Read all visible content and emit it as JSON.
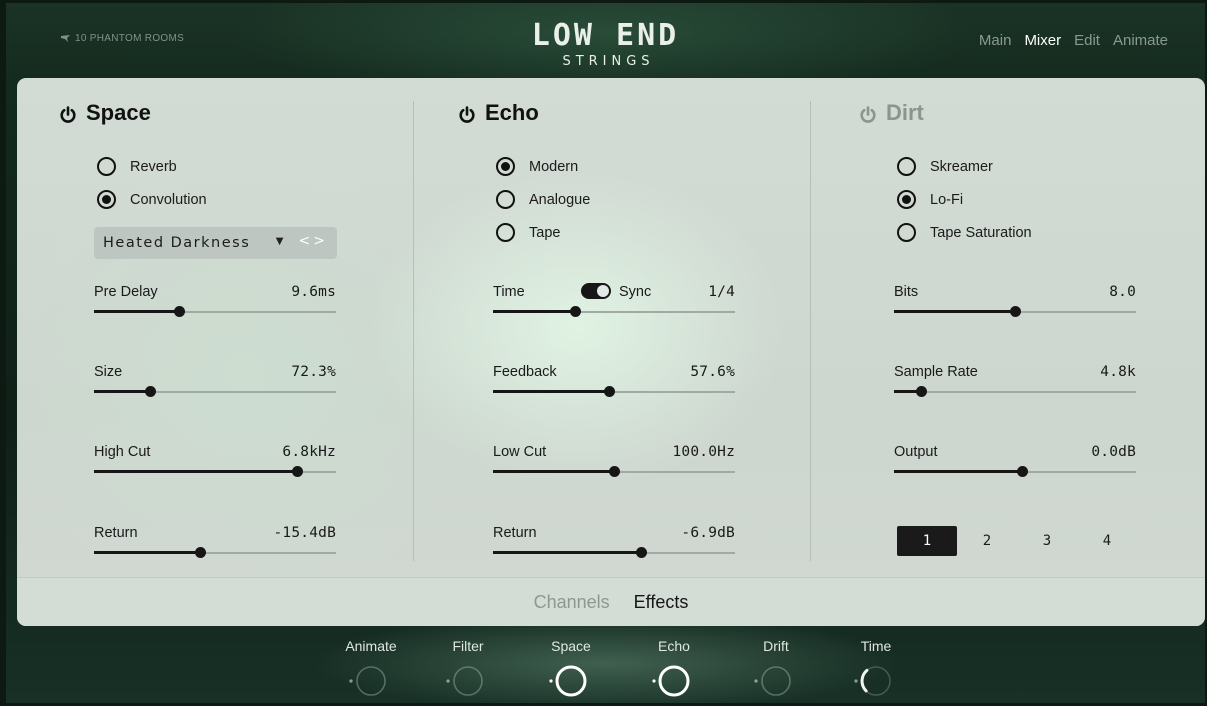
{
  "header": {
    "brand": "10 PHANTOM ROOMS",
    "title": "LOW END",
    "subtitle": "STRINGS",
    "nav": [
      "Main",
      "Mixer",
      "Edit",
      "Animate"
    ],
    "nav_active": "Mixer"
  },
  "space": {
    "title": "Space",
    "options": [
      "Reverb",
      "Convolution"
    ],
    "selected": "Convolution",
    "preset": "Heated Darkness",
    "params": [
      {
        "label": "Pre Delay",
        "value": "9.6ms",
        "level": 0.35
      },
      {
        "label": "Size",
        "value": "72.3%",
        "level": 0.23
      },
      {
        "label": "High Cut",
        "value": "6.8kHz",
        "level": 0.84
      },
      {
        "label": "Return",
        "value": "-15.4dB",
        "level": 0.44
      }
    ]
  },
  "echo": {
    "title": "Echo",
    "options": [
      "Modern",
      "Analogue",
      "Tape"
    ],
    "selected": "Modern",
    "sync_label": "Sync",
    "sync_on": true,
    "params": [
      {
        "label": "Time",
        "value": "1/4",
        "level": 0.34
      },
      {
        "label": "Feedback",
        "value": "57.6%",
        "level": 0.48
      },
      {
        "label": "Low Cut",
        "value": "100.0Hz",
        "level": 0.5
      },
      {
        "label": "Return",
        "value": "-6.9dB",
        "level": 0.61
      }
    ]
  },
  "dirt": {
    "title": "Dirt",
    "enabled": false,
    "options": [
      "Skreamer",
      "Lo-Fi",
      "Tape Saturation"
    ],
    "selected": "Lo-Fi",
    "params": [
      {
        "label": "Bits",
        "value": "8.0",
        "level": 0.5
      },
      {
        "label": "Sample Rate",
        "value": "4.8k",
        "level": 0.11
      },
      {
        "label": "Output",
        "value": "0.0dB",
        "level": 0.53
      }
    ],
    "pages": [
      "1",
      "2",
      "3",
      "4"
    ],
    "page_active": "1"
  },
  "tabs": {
    "items": [
      "Channels",
      "Effects"
    ],
    "active": "Effects"
  },
  "macros": [
    {
      "label": "Animate",
      "level": 0.0,
      "bright": false
    },
    {
      "label": "Filter",
      "level": 0.0,
      "bright": false
    },
    {
      "label": "Space",
      "level": 1.0,
      "bright": true
    },
    {
      "label": "Echo",
      "level": 1.0,
      "bright": true
    },
    {
      "label": "Drift",
      "level": 0.0,
      "bright": false
    },
    {
      "label": "Time",
      "level": 0.35,
      "bright": false
    }
  ],
  "colors": {
    "accent": "#161616",
    "panel": "#d0d8d2",
    "background": "#12261b"
  }
}
